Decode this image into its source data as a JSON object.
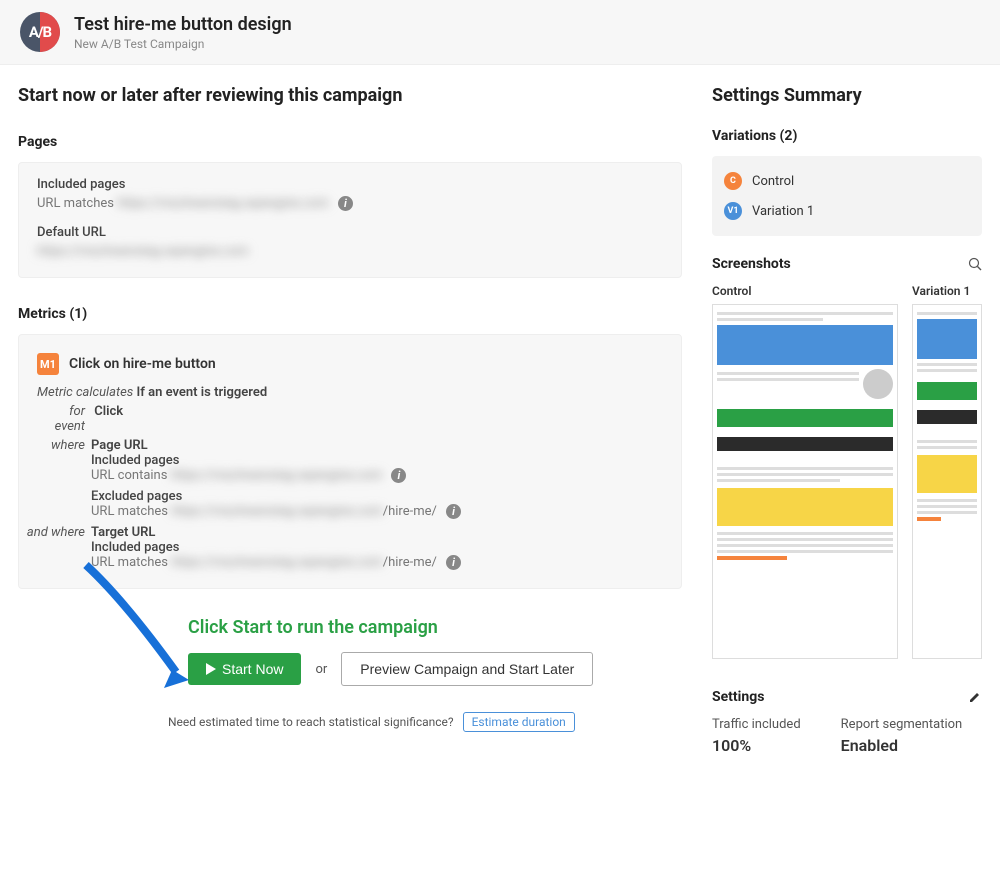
{
  "header": {
    "title": "Test hire-me button design",
    "subtitle": "New A/B Test Campaign",
    "logo_text": "A/B"
  },
  "left": {
    "heading": "Start now or later after reviewing this campaign",
    "pages": {
      "label": "Pages",
      "included_label": "Included pages",
      "url_matches_label": "URL matches",
      "url_matches_value": "https://mschwenstag.wpengine.com",
      "default_url_label": "Default URL",
      "default_url_value": "https://mschwenstag.wpengine.com"
    },
    "metrics": {
      "label": "Metrics (1)",
      "m1": {
        "badge": "M1",
        "title": "Click on hire-me button",
        "calc_prefix": "Metric calculates",
        "calc_value": "If an event is triggered",
        "for_event_label": "for event",
        "for_event_value": "Click",
        "where_label": "where",
        "page_url": "Page URL",
        "included_pages": "Included pages",
        "url_contains_label": "URL contains",
        "url_contains_value": "https://mschwenstag.wpengine.com",
        "excluded_pages": "Excluded pages",
        "url_matches_label2": "URL matches",
        "url_matches_value2": "https://mschwenstag.wpengine.com",
        "hire_me_suffix": "/hire-me/",
        "and_where_label": "and where",
        "target_url": "Target URL",
        "url_matches_value3": "https://mschwenstag.wpengine.com"
      }
    },
    "callout": "Click Start to run the campaign",
    "actions": {
      "start": "Start Now",
      "or": "or",
      "preview": "Preview Campaign and Start Later",
      "estimate_question": "Need estimated time to reach statistical significance?",
      "estimate_button": "Estimate duration"
    }
  },
  "right": {
    "heading": "Settings Summary",
    "variations": {
      "label": "Variations (2)",
      "c_badge": "C",
      "control": "Control",
      "v1_badge": "V1",
      "variation1": "Variation 1"
    },
    "screenshots": {
      "label": "Screenshots",
      "control": "Control",
      "variation1": "Variation 1"
    },
    "settings": {
      "label": "Settings",
      "traffic_label": "Traffic included",
      "traffic_value": "100%",
      "report_label": "Report segmentation",
      "report_value": "Enabled"
    }
  }
}
